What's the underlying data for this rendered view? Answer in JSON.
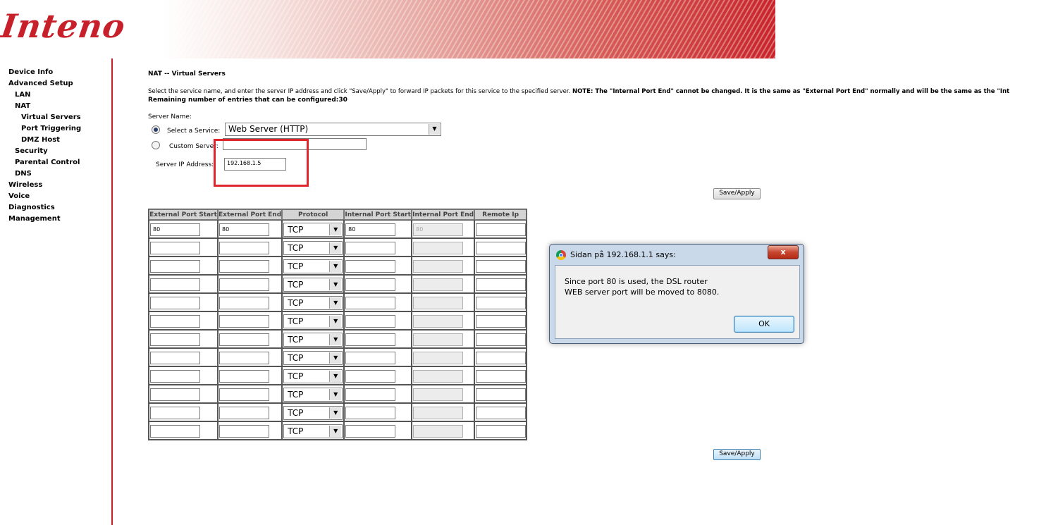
{
  "header": {
    "logo_text": "Inteno"
  },
  "sidebar": {
    "items": [
      {
        "label": "Device Info"
      },
      {
        "label": "Advanced Setup"
      },
      {
        "label": "LAN"
      },
      {
        "label": "NAT"
      },
      {
        "label": "Virtual Servers"
      },
      {
        "label": "Port Triggering"
      },
      {
        "label": "DMZ Host"
      },
      {
        "label": "Security"
      },
      {
        "label": "Parental Control"
      },
      {
        "label": "DNS"
      },
      {
        "label": "Wireless"
      },
      {
        "label": "Voice"
      },
      {
        "label": "Diagnostics"
      },
      {
        "label": "Management"
      }
    ]
  },
  "main": {
    "title": "NAT -- Virtual Servers",
    "description": "Select the service name, and enter the server IP address and click \"Save/Apply\" to forward IP packets for this service to the specified server. ",
    "note": "NOTE: The \"Internal Port End\" cannot be changed. It is the same as \"External Port End\" normally and will be the same as the \"Int",
    "remaining": "Remaining number of entries that can be configured:30",
    "server_name_label": "Server Name:",
    "select_service_label": "Select a Service:",
    "select_service_value": "Web Server (HTTP)",
    "custom_server_label": "Custom Server:",
    "custom_server_value": "",
    "server_ip_label": "Server IP Address:",
    "server_ip_value": "192.168.1.5",
    "save_apply": "Save/Apply"
  },
  "table": {
    "headers": [
      "External Port Start",
      "External Port End",
      "Protocol",
      "Internal Port Start",
      "Internal Port End",
      "Remote Ip"
    ],
    "rows": [
      {
        "ext_start": "80",
        "ext_end": "80",
        "protocol": "TCP",
        "int_start": "80",
        "int_end": "80",
        "remote_ip": ""
      },
      {
        "ext_start": "",
        "ext_end": "",
        "protocol": "TCP",
        "int_start": "",
        "int_end": "",
        "remote_ip": ""
      },
      {
        "ext_start": "",
        "ext_end": "",
        "protocol": "TCP",
        "int_start": "",
        "int_end": "",
        "remote_ip": ""
      },
      {
        "ext_start": "",
        "ext_end": "",
        "protocol": "TCP",
        "int_start": "",
        "int_end": "",
        "remote_ip": ""
      },
      {
        "ext_start": "",
        "ext_end": "",
        "protocol": "TCP",
        "int_start": "",
        "int_end": "",
        "remote_ip": ""
      },
      {
        "ext_start": "",
        "ext_end": "",
        "protocol": "TCP",
        "int_start": "",
        "int_end": "",
        "remote_ip": ""
      },
      {
        "ext_start": "",
        "ext_end": "",
        "protocol": "TCP",
        "int_start": "",
        "int_end": "",
        "remote_ip": ""
      },
      {
        "ext_start": "",
        "ext_end": "",
        "protocol": "TCP",
        "int_start": "",
        "int_end": "",
        "remote_ip": ""
      },
      {
        "ext_start": "",
        "ext_end": "",
        "protocol": "TCP",
        "int_start": "",
        "int_end": "",
        "remote_ip": ""
      },
      {
        "ext_start": "",
        "ext_end": "",
        "protocol": "TCP",
        "int_start": "",
        "int_end": "",
        "remote_ip": ""
      },
      {
        "ext_start": "",
        "ext_end": "",
        "protocol": "TCP",
        "int_start": "",
        "int_end": "",
        "remote_ip": ""
      },
      {
        "ext_start": "",
        "ext_end": "",
        "protocol": "TCP",
        "int_start": "",
        "int_end": "",
        "remote_ip": ""
      }
    ]
  },
  "dialog": {
    "title": "Sidan på 192.168.1.1 says:",
    "message_line1": "Since port 80 is used, the DSL router",
    "message_line2": "WEB server port will be moved to 8080.",
    "ok_label": "OK",
    "close_label": "x"
  },
  "colors": {
    "brand_red": "#c8202a",
    "highlight": "#e0262d"
  },
  "icons": {
    "dialog_icon": "chrome-icon",
    "close": "close-icon",
    "dropdown": "chevron-down-icon"
  }
}
